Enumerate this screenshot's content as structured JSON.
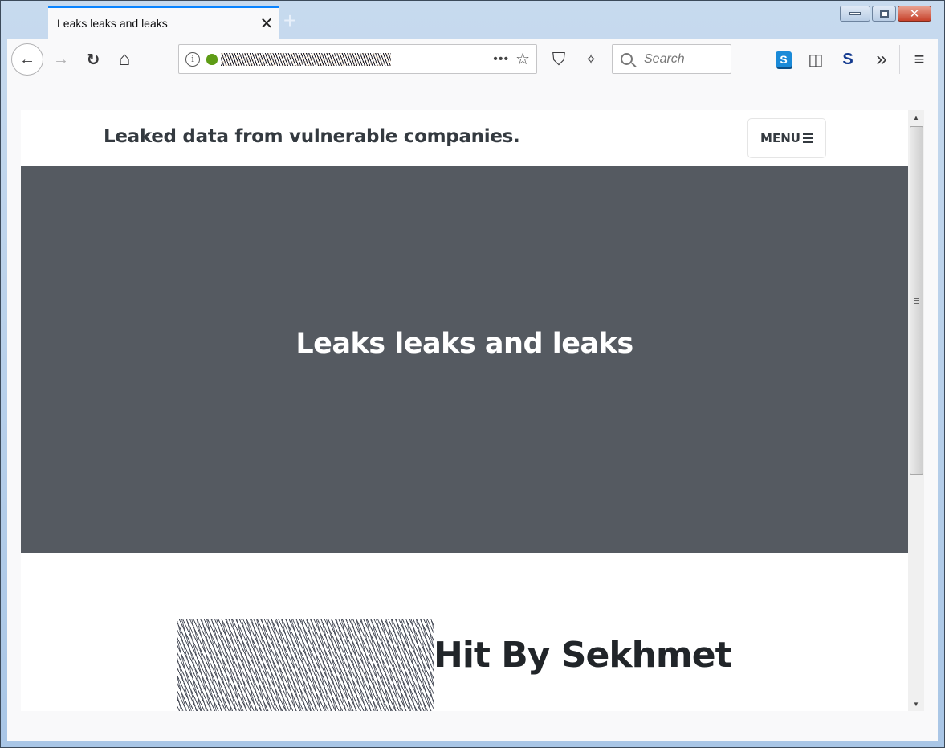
{
  "browser": {
    "tab": {
      "title": "Leaks leaks and leaks",
      "close_glyph": "✕"
    },
    "new_tab_glyph": "+",
    "window_controls": {
      "minimize": "minimize",
      "maximize": "maximize",
      "close_glyph": "✕"
    },
    "nav": {
      "back_glyph": "←",
      "forward_glyph": "→",
      "reload_glyph": "↻",
      "home_glyph": "⌂"
    },
    "urlbar": {
      "info_glyph": "i",
      "url": "[obscured onion address]",
      "more_glyph": "•••",
      "bookmark_glyph": "☆"
    },
    "toolbar": {
      "shield_glyph": "⛉",
      "broom_glyph": "✧",
      "search_placeholder": "Search",
      "skype_label": "S",
      "sidebar_glyph": "◫",
      "s_extension_label": "S",
      "overflow_glyph": "»",
      "menu_glyph": "≡"
    }
  },
  "page": {
    "brand": "Leaked data from vulnerable companies.",
    "menu_label": "MENU",
    "hero_title": "Leaks leaks and leaks",
    "post_title": "Hit By Sekhmet"
  },
  "colors": {
    "hero_bg": "#555a61",
    "text_dark": "#343a40",
    "tab_accent": "#0a84ff"
  }
}
